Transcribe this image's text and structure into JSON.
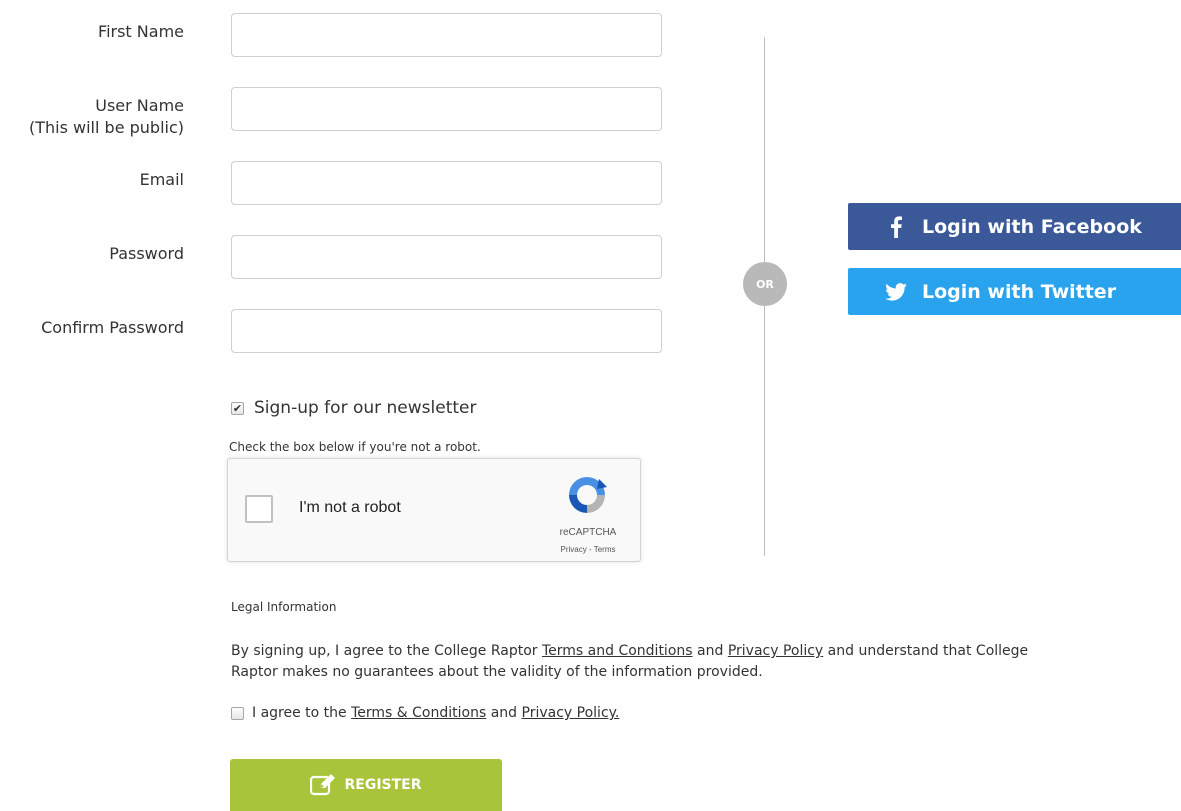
{
  "form": {
    "first_name": {
      "label": "First Name",
      "value": ""
    },
    "user_name": {
      "label_line1": "User Name",
      "label_line2": "(This will be public)",
      "value": ""
    },
    "email": {
      "label": "Email",
      "value": ""
    },
    "password": {
      "label": "Password",
      "value": ""
    },
    "confirm_password": {
      "label": "Confirm Password",
      "value": ""
    }
  },
  "newsletter": {
    "label": "Sign-up for our newsletter",
    "checked": true
  },
  "captcha": {
    "note": "Check the box below if you're not a robot.",
    "label": "I'm not a robot",
    "brand": "reCAPTCHA",
    "privacy": "Privacy",
    "separator": " - ",
    "terms": "Terms"
  },
  "divider": {
    "or_label": "OR"
  },
  "social": {
    "facebook_label": "Login with Facebook",
    "twitter_label": "Login with Twitter",
    "facebook_color": "#3b5998",
    "twitter_color": "#2aa3ef"
  },
  "legal": {
    "heading": "Legal Information",
    "line1_pre": "By signing up, I agree to the College Raptor ",
    "terms_link": "Terms and Conditions",
    "and": " and ",
    "privacy_link": "Privacy Policy",
    "line1_post": " and understand that College",
    "line2": "Raptor makes no guarantees about the validity of the information provided."
  },
  "agree": {
    "pre": "I agree to the ",
    "terms_link": "Terms & Conditions",
    "and": " and ",
    "privacy_link": "Privacy Policy.",
    "checked": false
  },
  "register": {
    "label": "REGISTER",
    "color": "#a8c43a"
  }
}
